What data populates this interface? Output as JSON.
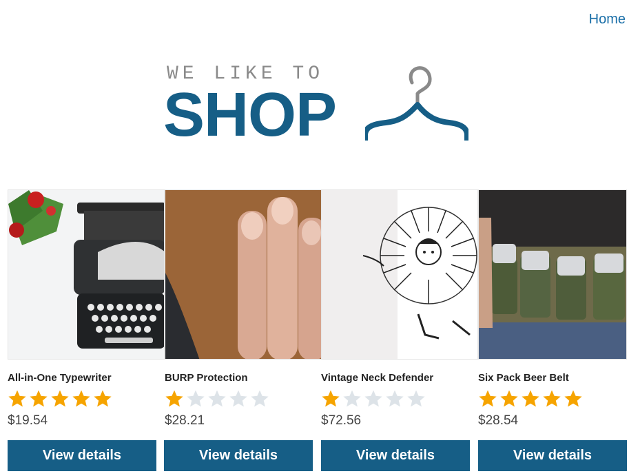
{
  "nav": {
    "home_label": "Home"
  },
  "logo": {
    "top_text": "WE LIKE TO",
    "main_text": "SHOP"
  },
  "colors": {
    "brand": "#165e86",
    "link": "#1a6fa8",
    "star_on": "#f6a400",
    "star_off": "#dde3e8"
  },
  "products": [
    {
      "title": "All-in-One Typewriter",
      "rating": 5,
      "price": "$19.54",
      "button": "View details",
      "image": "typewriter-photo"
    },
    {
      "title": "BURP Protection",
      "rating": 1,
      "price": "$28.21",
      "button": "View details",
      "image": "beard-hand-photo"
    },
    {
      "title": "Vintage Neck Defender",
      "rating": 1,
      "price": "$72.56",
      "button": "View details",
      "image": "ruff-collar-illustration"
    },
    {
      "title": "Six Pack Beer Belt",
      "rating": 5,
      "price": "$28.54",
      "button": "View details",
      "image": "beer-belt-photo"
    }
  ]
}
